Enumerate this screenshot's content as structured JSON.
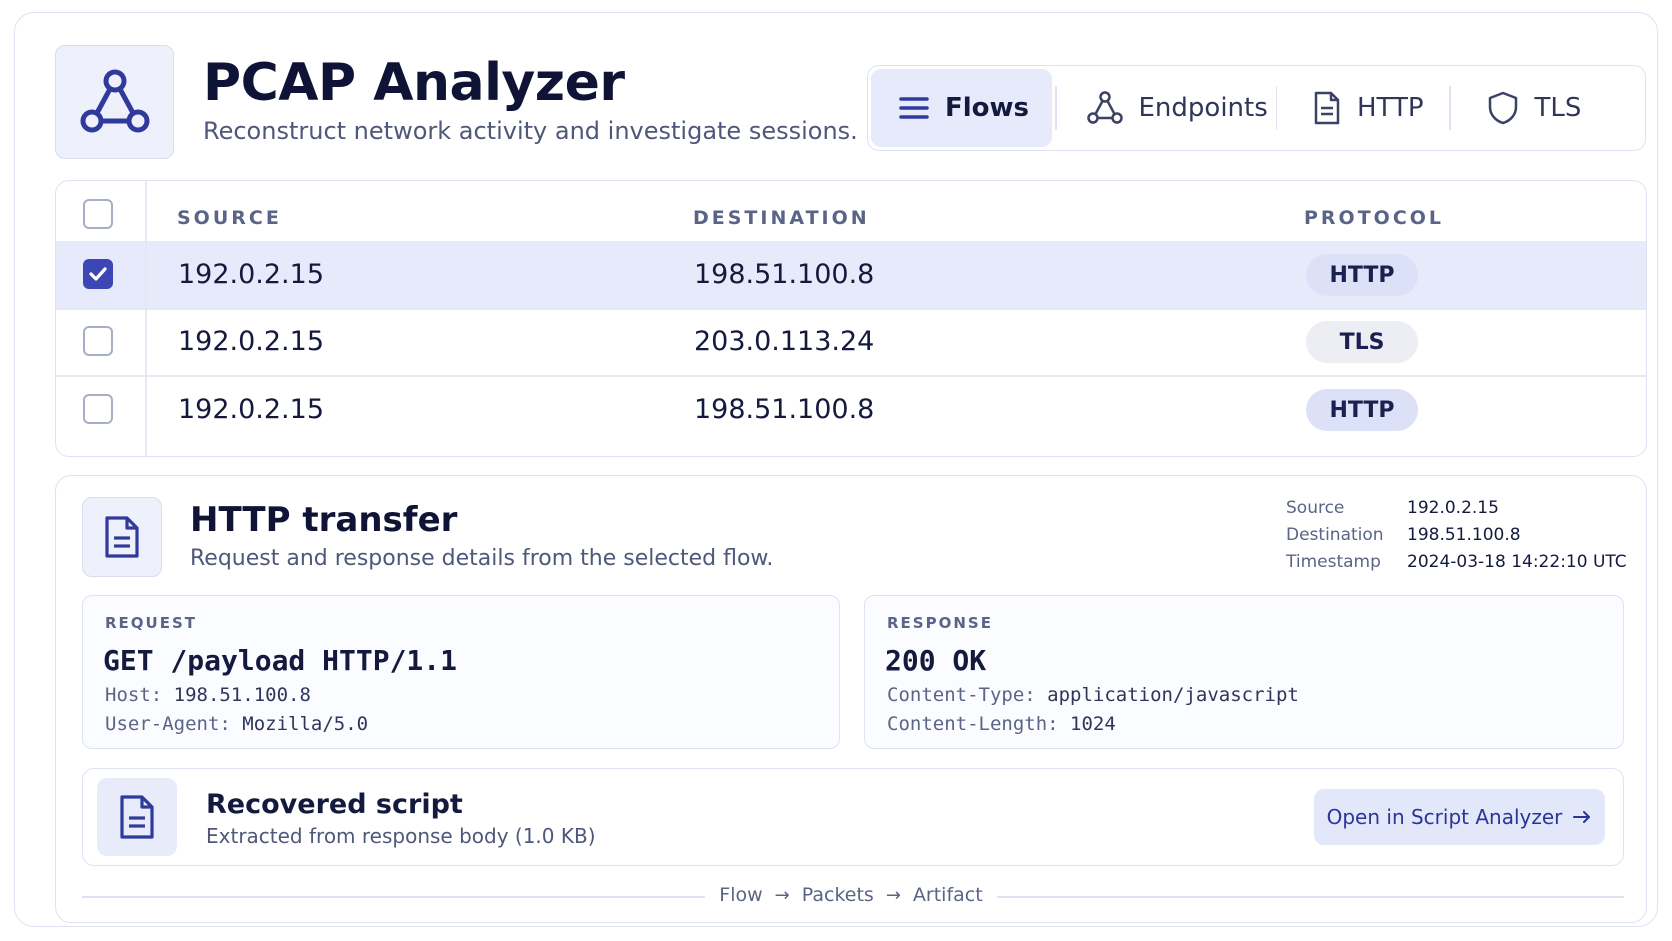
{
  "app": {
    "title": "PCAP Analyzer",
    "subtitle": "Reconstruct network activity and investigate sessions.",
    "logo_icon": "network-graph-icon"
  },
  "tabs": [
    {
      "label": "Flows",
      "icon": "list-icon",
      "active": true
    },
    {
      "label": "Endpoints",
      "icon": "network-graph-icon",
      "active": false
    },
    {
      "label": "HTTP",
      "icon": "document-icon",
      "active": false
    },
    {
      "label": "TLS",
      "icon": "shield-icon",
      "active": false
    }
  ],
  "flows": {
    "columns": {
      "source": "SOURCE",
      "destination": "DESTINATION",
      "protocol": "PROTOCOL"
    },
    "rows": [
      {
        "source": "192.0.2.15",
        "destination": "198.51.100.8",
        "protocol": "HTTP",
        "checked": true
      },
      {
        "source": "192.0.2.15",
        "destination": "203.0.113.24",
        "protocol": "TLS",
        "checked": false
      },
      {
        "source": "192.0.2.15",
        "destination": "198.51.100.8",
        "protocol": "HTTP",
        "checked": false
      }
    ]
  },
  "detail": {
    "title": "HTTP transfer",
    "subtitle": "Request and response details from the selected flow.",
    "meta": [
      {
        "label": "Source",
        "value": "192.0.2.15"
      },
      {
        "label": "Destination",
        "value": "198.51.100.8"
      },
      {
        "label": "Timestamp",
        "value": "2024-03-18 14:22:10 UTC"
      }
    ],
    "request": {
      "label": "REQUEST",
      "line": "GET /payload HTTP/1.1",
      "headers": [
        {
          "key": "Host:",
          "value": "198.51.100.8"
        },
        {
          "key": "User-Agent:",
          "value": "Mozilla/5.0"
        }
      ]
    },
    "response": {
      "label": "RESPONSE",
      "line": "200 OK",
      "headers": [
        {
          "key": "Content-Type:",
          "value": "application/javascript"
        },
        {
          "key": "Content-Length:",
          "value": "1024"
        }
      ]
    },
    "artifact": {
      "title": "Recovered script",
      "subtitle": "Extracted from response body (1.0 KB)",
      "button": "Open in Script Analyzer"
    },
    "breadcrumb": [
      "Flow",
      "Packets",
      "Artifact"
    ]
  },
  "colors": {
    "accent": "#3c47b5",
    "selected_row": "#e7eafb",
    "border": "#dfe3f1"
  }
}
